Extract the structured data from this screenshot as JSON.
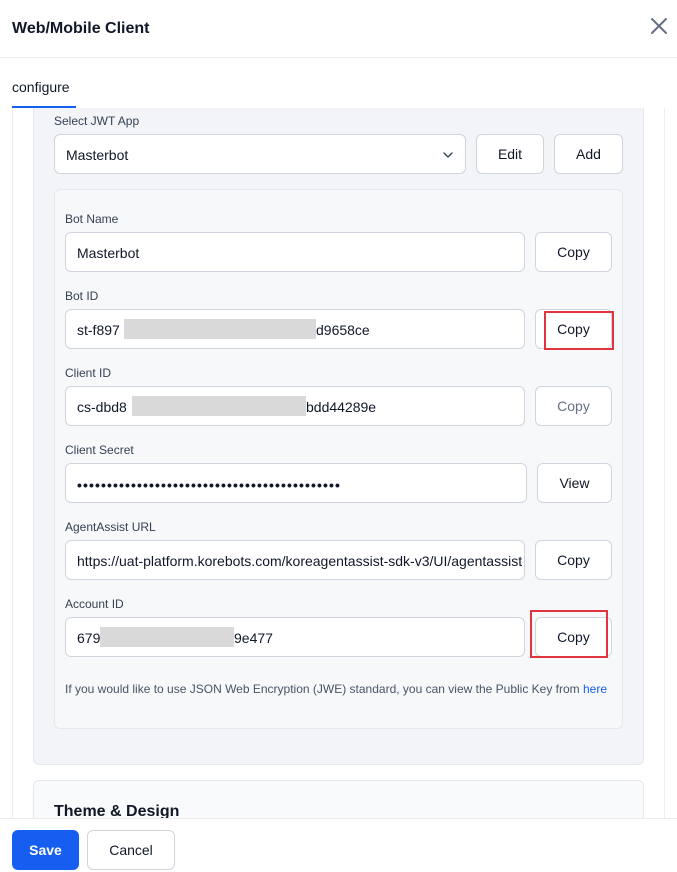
{
  "window": {
    "title": "Web/Mobile Client"
  },
  "tabs": [
    {
      "label": "configure",
      "active": true
    }
  ],
  "jwt": {
    "select_label": "Select JWT App",
    "selected_value": "Masterbot",
    "edit_label": "Edit",
    "add_label": "Add"
  },
  "fields": {
    "bot_name": {
      "label": "Bot Name",
      "value": "Masterbot",
      "action": "Copy"
    },
    "bot_id": {
      "label": "Bot ID",
      "value_start": "st-f897",
      "value_end": "d9658ce",
      "action": "Copy"
    },
    "client_id": {
      "label": "Client ID",
      "value_start": "cs-dbd8",
      "value_end": "bdd44289e",
      "action": "Copy"
    },
    "client_secret": {
      "label": "Client Secret",
      "value": "••••••••••••••••••••••••••••••••••••••••••••",
      "action": "View"
    },
    "agentassist_url": {
      "label": "AgentAssist URL",
      "value": "https://uat-platform.korebots.com/koreagentassist-sdk-v3/UI/agentassist",
      "action": "Copy"
    },
    "account_id": {
      "label": "Account ID",
      "value_start": "679",
      "value_end": "9e477",
      "action": "Copy"
    }
  },
  "jwe_note": {
    "text": "If you would like to use JSON Web Encryption (JWE) standard, you can view the Public Key from ",
    "link": "here"
  },
  "theme": {
    "title": "Theme & Design"
  },
  "footer": {
    "save_label": "Save",
    "cancel_label": "Cancel"
  },
  "colors": {
    "primary": "#155eef",
    "highlight": "#e0353f",
    "card_bg": "#f2f4f7"
  },
  "icons": {
    "close": "close-icon",
    "select_chevron": "chevron-down-icon"
  }
}
